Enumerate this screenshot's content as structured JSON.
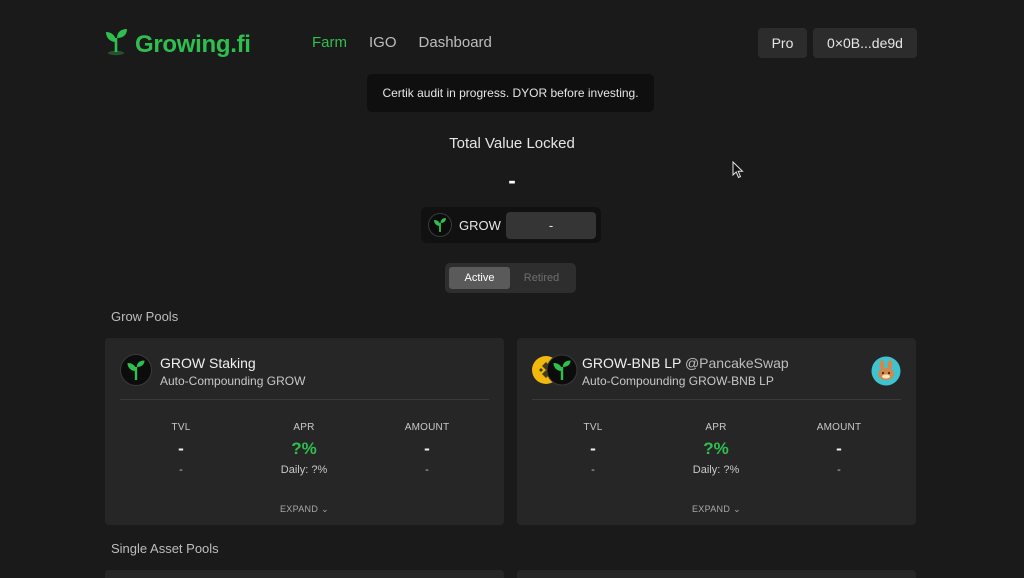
{
  "brand": {
    "name": "Growing.fi",
    "color": "#2fbf4f"
  },
  "nav": [
    {
      "label": "Farm",
      "active": true
    },
    {
      "label": "IGO",
      "active": false
    },
    {
      "label": "Dashboard",
      "active": false
    }
  ],
  "header": {
    "pro_label": "Pro",
    "wallet_label": "0×0B...de9d"
  },
  "notice": {
    "text": "Certik audit in progress. DYOR before investing."
  },
  "tvl": {
    "title": "Total Value Locked",
    "value": "-"
  },
  "grow_price": {
    "token": "GROW",
    "value": "-"
  },
  "pool_filter": {
    "active_label": "Active",
    "retired_label": "Retired"
  },
  "sections": {
    "grow_pools": "Grow Pools",
    "single_asset_pools": "Single Asset Pools"
  },
  "pools": [
    {
      "name": "GROW Staking",
      "platform": "",
      "subtitle": "Auto-Compounding GROW",
      "tvl_label": "TVL",
      "tvl_value": "-",
      "tvl_sub": "-",
      "apr_label": "APR",
      "apr_value": "?%",
      "apr_sub": "Daily: ?%",
      "amount_label": "AMOUNT",
      "amount_value": "-",
      "amount_sub": "-",
      "expand_label": "EXPAND"
    },
    {
      "name": "GROW-BNB LP",
      "platform": "@PancakeSwap",
      "subtitle": "Auto-Compounding GROW-BNB LP",
      "tvl_label": "TVL",
      "tvl_value": "-",
      "tvl_sub": "-",
      "apr_label": "APR",
      "apr_value": "?%",
      "apr_sub": "Daily: ?%",
      "amount_label": "AMOUNT",
      "amount_value": "-",
      "amount_sub": "-",
      "expand_label": "EXPAND"
    }
  ],
  "icons": {
    "logo": "sprout-icon",
    "grow_token": "grow-token-icon",
    "bnb_token": "bnb-token-icon",
    "pancakeswap": "pancakeswap-bunny-icon",
    "chevron": "chevron-down-icon"
  }
}
